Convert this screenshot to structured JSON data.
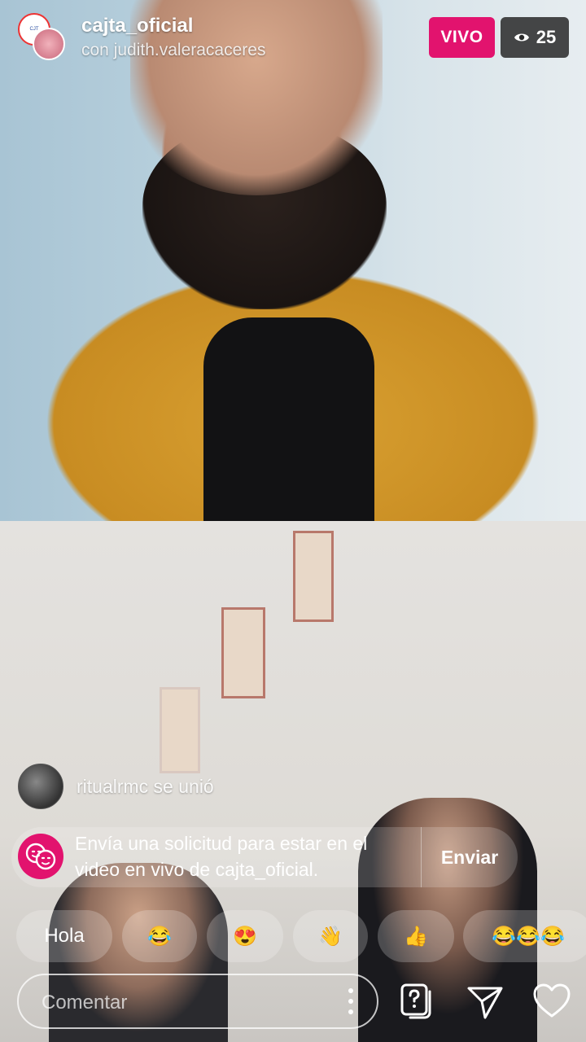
{
  "header": {
    "host": "cajta_oficial",
    "guest_line": "con judith.valeracaceres",
    "live_label": "VIVO",
    "viewer_count": "25"
  },
  "feed": {
    "join_text": "ritualrmc se unió"
  },
  "request": {
    "text": "Envía una solicitud para estar en el video en vivo de cajta_oficial.",
    "send_label": "Enviar"
  },
  "quick_replies": [
    {
      "label": "Hola"
    },
    {
      "label": "😂"
    },
    {
      "label": "😍"
    },
    {
      "label": "👋"
    },
    {
      "label": "👍"
    },
    {
      "label": "😂😂😂"
    }
  ],
  "comment": {
    "placeholder": "Comentar"
  },
  "icons": {
    "viewers": "eye-icon",
    "more": "more-vertical-icon",
    "question": "question-card-icon",
    "send": "send-icon",
    "like": "heart-icon",
    "request": "masks-icon"
  },
  "colors": {
    "live_badge": "#e2136e",
    "request_icon_bg": "#e2136e"
  }
}
